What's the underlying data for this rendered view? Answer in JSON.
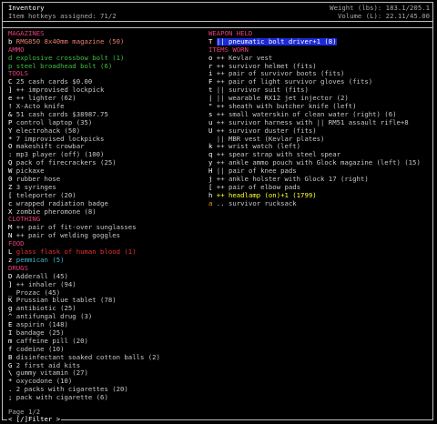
{
  "title": "Inventory",
  "hotkeys": "Item hotkeys assigned: 71/2",
  "weight": "Weight (lbs): 183.1/205.1",
  "volume": "Volume (L): 22.11/45.00",
  "page": "Page 1/2",
  "filter": "< [/]Filter >",
  "colors": {
    "header": "#e5407a",
    "default": "#c8c8c8",
    "white": "#ffffff",
    "green": "#3ec03e",
    "cyan": "#3fb7c8",
    "red": "#e83030",
    "yellow": "#ffff33",
    "orange": "#ff9a1a",
    "highlight_bg": "#1a2bd6"
  },
  "left": [
    {
      "type": "header",
      "text": "MAGAZINES"
    },
    {
      "key": "b",
      "text": "RMG850 8x40mm magazine (50)",
      "color": "#e88070",
      "key_color": "#ffffff"
    },
    {
      "type": "header",
      "text": "AMMO"
    },
    {
      "key": "d",
      "text": "explosive crossbow bolt (1)",
      "color": "#3ec03e",
      "key_color": "#3ec03e"
    },
    {
      "key": "p",
      "text": "steel broadhead bolt (6)",
      "color": "#3ec03e",
      "key_color": "#3ec03e"
    },
    {
      "type": "header",
      "text": "TOOLS"
    },
    {
      "key": "C",
      "text": "25 cash cards $0.00",
      "color": "#c8c8c8"
    },
    {
      "key": "]",
      "text": "++ improvised lockpick",
      "color": "#c8c8c8"
    },
    {
      "key": "e",
      "text": "++ lighter (62)",
      "color": "#c8c8c8"
    },
    {
      "key": "!",
      "text": "X-Acto knife",
      "color": "#c8c8c8"
    },
    {
      "key": "&",
      "text": "51 cash cards $38987.75",
      "color": "#c8c8c8"
    },
    {
      "key": "P",
      "text": "control laptop (35)",
      "color": "#c8c8c8"
    },
    {
      "key": "Y",
      "text": "electrohack (50)",
      "color": "#c8c8c8"
    },
    {
      "key": "*",
      "text": "7 improvised lockpicks",
      "color": "#c8c8c8"
    },
    {
      "key": "O",
      "text": "makeshift crowbar",
      "color": "#c8c8c8"
    },
    {
      "key": ":",
      "text": "mp3 player (off) (100)",
      "color": "#c8c8c8"
    },
    {
      "key": "Q",
      "text": "pack of firecrackers (25)",
      "color": "#c8c8c8"
    },
    {
      "key": "W",
      "text": "pickaxe",
      "color": "#c8c8c8"
    },
    {
      "key": "0",
      "text": "rubber hose",
      "color": "#c8c8c8"
    },
    {
      "key": "Z",
      "text": "3 syringes",
      "color": "#c8c8c8"
    },
    {
      "key": "[",
      "text": "teleporter (20)",
      "color": "#c8c8c8"
    },
    {
      "key": "c",
      "text": "wrapped radiation badge",
      "color": "#c8c8c8"
    },
    {
      "key": "X",
      "text": "zombie pheromone (8)",
      "color": "#c8c8c8"
    },
    {
      "type": "header",
      "text": "CLOTHING"
    },
    {
      "key": "M",
      "text": "++ pair of fit-over sunglasses",
      "color": "#c8c8c8"
    },
    {
      "key": "N",
      "text": "++ pair of welding goggles",
      "color": "#c8c8c8"
    },
    {
      "type": "header",
      "text": "FOOD"
    },
    {
      "key": "L",
      "text": "glass flask of human blood (1)",
      "color": "#e83030"
    },
    {
      "key": "z",
      "text": "pemmican (5)",
      "color": "#3fb7c8"
    },
    {
      "type": "header",
      "text": "DRUGS"
    },
    {
      "key": "D",
      "text": "Adderall (45)",
      "color": "#c8c8c8"
    },
    {
      "key": "]",
      "text": "++ inhaler (94)",
      "color": "#c8c8c8"
    },
    {
      "key": "_",
      "text": "Prozac (45)",
      "color": "#c8c8c8"
    },
    {
      "key": "K",
      "text": "Prussian blue tablet (78)",
      "color": "#c8c8c8"
    },
    {
      "key": "g",
      "text": "antibiotic (25)",
      "color": "#c8c8c8"
    },
    {
      "key": "^",
      "text": "antifungal drug (3)",
      "color": "#c8c8c8"
    },
    {
      "key": "E",
      "text": "aspirin (148)",
      "color": "#c8c8c8"
    },
    {
      "key": "I",
      "text": "bandage (25)",
      "color": "#c8c8c8"
    },
    {
      "key": "m",
      "text": "caffeine pill (20)",
      "color": "#c8c8c8"
    },
    {
      "key": "f",
      "text": "codeine (10)",
      "color": "#c8c8c8"
    },
    {
      "key": "B",
      "text": "disinfectant soaked cotton balls (2)",
      "color": "#c8c8c8"
    },
    {
      "key": "G",
      "text": "2 first aid kits",
      "color": "#c8c8c8"
    },
    {
      "key": "\\",
      "text": "gummy vitamin (27)",
      "color": "#c8c8c8"
    },
    {
      "key": "*",
      "text": "oxycodone (10)",
      "color": "#c8c8c8"
    },
    {
      "key": ".",
      "text": "2 packs with cigarettes (20)",
      "color": "#c8c8c8"
    },
    {
      "key": ";",
      "text": "pack with cigarette (6)",
      "color": "#c8c8c8"
    }
  ],
  "right": [
    {
      "type": "header",
      "text": "WEAPON HELD"
    },
    {
      "key": "T",
      "text": "|| pneumatic bolt driver+1 (8)",
      "color": "#ffffff",
      "highlight": true
    },
    {
      "type": "header",
      "text": "ITEMS WORN"
    },
    {
      "key": "o",
      "text": "++ Kevlar vest",
      "color": "#c8c8c8"
    },
    {
      "key": "r",
      "text": "++ survivor helmet (fits)",
      "color": "#c8c8c8"
    },
    {
      "key": "i",
      "text": "++ pair of survivor boots (fits)",
      "color": "#c8c8c8"
    },
    {
      "key": "F",
      "text": "++ pair of light survivor gloves (fits)",
      "color": "#c8c8c8"
    },
    {
      "key": "t",
      "text": "|| survivor suit (fits)",
      "color": "#c8c8c8"
    },
    {
      "key": "|",
      "text": "|| wearable RX12 jet injector (2)",
      "color": "#c8c8c8"
    },
    {
      "key": "\"",
      "text": "++ sheath with butcher knife (left)",
      "color": "#c8c8c8"
    },
    {
      "key": "s",
      "text": "++ small waterskin of clean water (right) (6)",
      "color": "#c8c8c8"
    },
    {
      "key": "u",
      "text": "++ survivor harness with || RM51 assault rifle+8",
      "color": "#c8c8c8"
    },
    {
      "key": "U",
      "text": "++ survivor duster (fits)",
      "color": "#c8c8c8"
    },
    {
      "key": "",
      "text": "|| MBR vest (Kevlar plates)",
      "color": "#c8c8c8"
    },
    {
      "key": "k",
      "text": "++ wrist watch (left)",
      "color": "#c8c8c8"
    },
    {
      "key": "q",
      "text": "++ spear strap with steel spear",
      "color": "#c8c8c8"
    },
    {
      "key": "y",
      "text": "++ ankle ammo pouch with Glock magazine (left) (15)",
      "color": "#c8c8c8"
    },
    {
      "key": "H",
      "text": "|| pair of knee pads",
      "color": "#c8c8c8"
    },
    {
      "key": "j",
      "text": "++ ankle holster with Glock 17 (right)",
      "color": "#c8c8c8"
    },
    {
      "key": "[",
      "text": "++ pair of elbow pads",
      "color": "#c8c8c8"
    },
    {
      "key": "h",
      "text": "++ headlamp (on)+1 (1799)",
      "color": "#ffff33"
    },
    {
      "key": "a",
      "text": ".. survivor rucksack",
      "color": "#c8c8c8",
      "key_color": "#ff9a1a"
    }
  ]
}
